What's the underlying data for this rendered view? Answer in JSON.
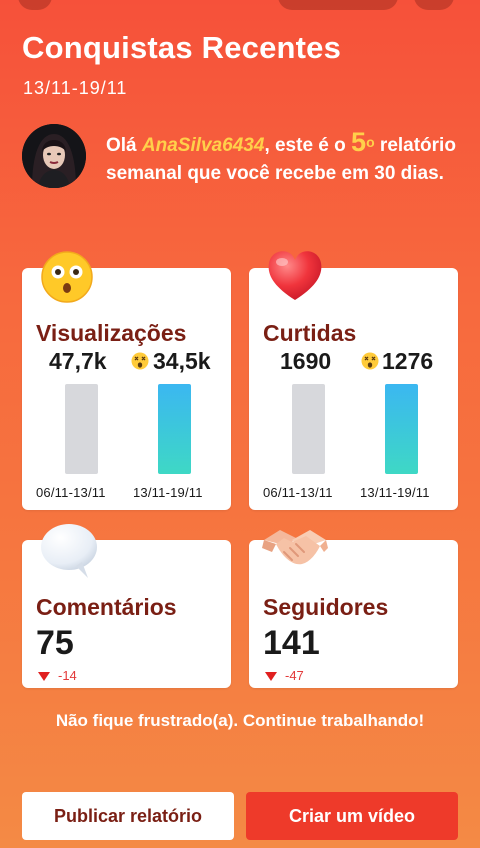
{
  "header": {
    "title": "Conquistas Recentes",
    "date_range": "13/11-19/11"
  },
  "greeting": {
    "prefix": "Olá ",
    "username": "AnaSilva6434",
    "middle": ", este é o ",
    "report_number": "5",
    "ordinal": "o",
    "suffix": " relatório semanal que você recebe em 30 dias."
  },
  "views": {
    "title": "Visualizações",
    "previous": "47,7k",
    "current": "34,5k",
    "previous_label": "06/11-13/11",
    "current_label": "13/11-19/11",
    "chart_data": {
      "type": "bar",
      "categories": [
        "06/11-13/11",
        "13/11-19/11"
      ],
      "values": [
        47700,
        34500
      ]
    }
  },
  "likes": {
    "title": "Curtidas",
    "previous": "1690",
    "current": "1276",
    "previous_label": "06/11-13/11",
    "current_label": "13/11-19/11",
    "chart_data": {
      "type": "bar",
      "categories": [
        "06/11-13/11",
        "13/11-19/11"
      ],
      "values": [
        1690,
        1276
      ]
    }
  },
  "comments": {
    "title": "Comentários",
    "value": "75",
    "delta": "-14"
  },
  "followers": {
    "title": "Seguidores",
    "value": "141",
    "delta": "-47"
  },
  "footer": {
    "message": "Não fique frustrado(a). Continue trabalhando!",
    "publish_label": "Publicar relatório",
    "create_label": "Criar um vídeo"
  },
  "colors": {
    "accent": "#ee3a2a",
    "title_dark_red": "#7a1f14",
    "highlight_yellow": "#ffd04a",
    "bar_current": "#3bb7f1",
    "bar_previous": "#d7d8dc",
    "decline_red": "#e02020"
  },
  "icons": [
    "astonished-face-emoji",
    "red-heart-emoji",
    "speech-bubble-emoji",
    "handshake-emoji",
    "dizzy-face-emoji"
  ]
}
